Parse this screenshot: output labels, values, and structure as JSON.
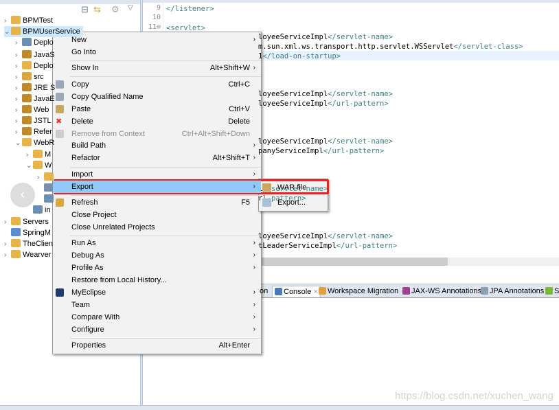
{
  "explorer": {
    "items": [
      {
        "label": "BPMTest",
        "arrow": "›",
        "indent": 0,
        "color": "#e6b54a"
      },
      {
        "label": "BPMUserService",
        "arrow": "⌄",
        "indent": 0,
        "color": "#e6b54a",
        "selected": true
      },
      {
        "label": "Deplo",
        "arrow": "›",
        "indent": 1,
        "color": "#6b8fb3"
      },
      {
        "label": "JavaS",
        "arrow": "›",
        "indent": 1,
        "color": "#c08a2a"
      },
      {
        "label": "Deplo",
        "arrow": "›",
        "indent": 1,
        "color": "#e6b54a"
      },
      {
        "label": "src",
        "arrow": "›",
        "indent": 1,
        "color": "#d9a640"
      },
      {
        "label": "JRE S",
        "arrow": "›",
        "indent": 1,
        "color": "#c08a2a"
      },
      {
        "label": "JavaE",
        "arrow": "›",
        "indent": 1,
        "color": "#c08a2a"
      },
      {
        "label": "Web",
        "arrow": "›",
        "indent": 1,
        "color": "#c08a2a"
      },
      {
        "label": "JSTL",
        "arrow": "›",
        "indent": 1,
        "color": "#c08a2a"
      },
      {
        "label": "Refer",
        "arrow": "›",
        "indent": 1,
        "color": "#c08a2a"
      },
      {
        "label": "WebR",
        "arrow": "⌄",
        "indent": 1,
        "color": "#e6b54a"
      },
      {
        "label": "M",
        "arrow": "›",
        "indent": 2,
        "color": "#e6b54a"
      },
      {
        "label": "W",
        "arrow": "⌄",
        "indent": 2,
        "color": "#e6b54a"
      },
      {
        "label": "",
        "arrow": "›",
        "indent": 3,
        "color": "#e6b54a"
      },
      {
        "label": "",
        "arrow": "",
        "indent": 3,
        "color": "#7a8fb0"
      },
      {
        "label": "",
        "arrow": "",
        "indent": 3,
        "color": "#6b8fb3"
      },
      {
        "label": "in",
        "arrow": "",
        "indent": 2,
        "color": "#6b8fb3"
      },
      {
        "label": "Servers",
        "arrow": "›",
        "indent": 0,
        "color": "#e6b54a"
      },
      {
        "label": "SpringM",
        "arrow": "",
        "indent": 0,
        "color": "#5b8fd0"
      },
      {
        "label": "TheClien",
        "arrow": "›",
        "indent": 0,
        "color": "#e6b54a"
      },
      {
        "label": "Wearver",
        "arrow": "›",
        "indent": 0,
        "color": "#e6b54a"
      }
    ]
  },
  "editor": {
    "line_numbers": [
      "9",
      "10",
      "11⊖"
    ],
    "lines": [
      {
        "text": "",
        "tag": "</listener>"
      },
      {
        "text": "",
        "tag": ""
      },
      {
        "text": "",
        "tag": "<servlet>"
      },
      {
        "text": "loyeeServiceImpl",
        "tag": "</servlet-name>"
      },
      {
        "text": "m.sun.xml.ws.transport.http.servlet.WSServlet",
        "tag": "</servlet-class>"
      },
      {
        "text": "1",
        "tag": "</load-on-startup>"
      },
      {
        "text": "loyeeServiceImpl",
        "tag": "</servlet-name>"
      },
      {
        "text": "loyeeServiceImpl",
        "tag": "</url-pattern>"
      },
      {
        "text": "loyeeServiceImpl",
        "tag": "</servlet-name>"
      },
      {
        "text": "panyServiceImpl",
        "tag": "</url-pattern>"
      },
      {
        "text": "1",
        "tag": "</servlet-name>"
      },
      {
        "text": "r",
        "tag": "l-pattern>"
      },
      {
        "text": "loyeeServiceImpl",
        "tag": "</servlet-name>"
      },
      {
        "text": "tLeaderServiceImpl",
        "tag": "</url-pattern>"
      }
    ]
  },
  "bottom_tabs": [
    {
      "label": "on",
      "icon": "",
      "active": false
    },
    {
      "label": "Console",
      "icon": "console-icon",
      "active": true,
      "close": "×"
    },
    {
      "label": "Workspace Migration",
      "icon": "migration-icon",
      "active": false
    },
    {
      "label": "JAX-WS Annotations",
      "icon": "jaxws-icon",
      "active": false
    },
    {
      "label": "JPA Annotations",
      "icon": "jpa-icon",
      "active": false
    },
    {
      "label": "S",
      "icon": "spring-icon",
      "active": false
    }
  ],
  "context_menu": {
    "items": [
      {
        "label": "New",
        "shortcut": "",
        "submenu": true
      },
      {
        "label": "Go Into",
        "shortcut": "",
        "submenu": false
      },
      {
        "label": "Show In",
        "shortcut": "Alt+Shift+W",
        "submenu": true
      },
      {
        "label": "Copy",
        "shortcut": "Ctrl+C",
        "icon": "copy-icon"
      },
      {
        "label": "Copy Qualified Name",
        "shortcut": "",
        "icon": "copy-qualified-icon"
      },
      {
        "label": "Paste",
        "shortcut": "Ctrl+V",
        "icon": "paste-icon"
      },
      {
        "label": "Delete",
        "shortcut": "Delete",
        "icon": "delete-icon"
      },
      {
        "label": "Remove from Context",
        "shortcut": "Ctrl+Alt+Shift+Down",
        "icon": "remove-icon",
        "disabled": true
      },
      {
        "label": "Build Path",
        "shortcut": "",
        "submenu": true
      },
      {
        "label": "Refactor",
        "shortcut": "Alt+Shift+T",
        "submenu": true
      },
      {
        "label": "Import",
        "shortcut": "",
        "submenu": true
      },
      {
        "label": "Export",
        "shortcut": "",
        "submenu": true,
        "active": true
      },
      {
        "label": "Refresh",
        "shortcut": "F5",
        "icon": "refresh-icon"
      },
      {
        "label": "Close Project",
        "shortcut": ""
      },
      {
        "label": "Close Unrelated Projects",
        "shortcut": ""
      },
      {
        "label": "Run As",
        "shortcut": "",
        "submenu": true
      },
      {
        "label": "Debug As",
        "shortcut": "",
        "submenu": true
      },
      {
        "label": "Profile As",
        "shortcut": "",
        "submenu": true
      },
      {
        "label": "Restore from Local History...",
        "shortcut": ""
      },
      {
        "label": "MyEclipse",
        "shortcut": "",
        "submenu": true,
        "icon": "myeclipse-icon"
      },
      {
        "label": "Team",
        "shortcut": "",
        "submenu": true
      },
      {
        "label": "Compare With",
        "shortcut": "",
        "submenu": true
      },
      {
        "label": "Configure",
        "shortcut": "",
        "submenu": true
      },
      {
        "label": "Properties",
        "shortcut": "Alt+Enter"
      }
    ]
  },
  "export_submenu": {
    "items": [
      {
        "label": "WAR file",
        "icon": "war-file-icon"
      },
      {
        "label": "Export...",
        "icon": "export-wizard-icon"
      }
    ]
  },
  "watermark": "https://blog.csdn.net/xuchen_wang",
  "colors": {
    "highlight": "#91c9f7",
    "red_box": "#f01e1e",
    "tag": "#3f7f7f"
  }
}
